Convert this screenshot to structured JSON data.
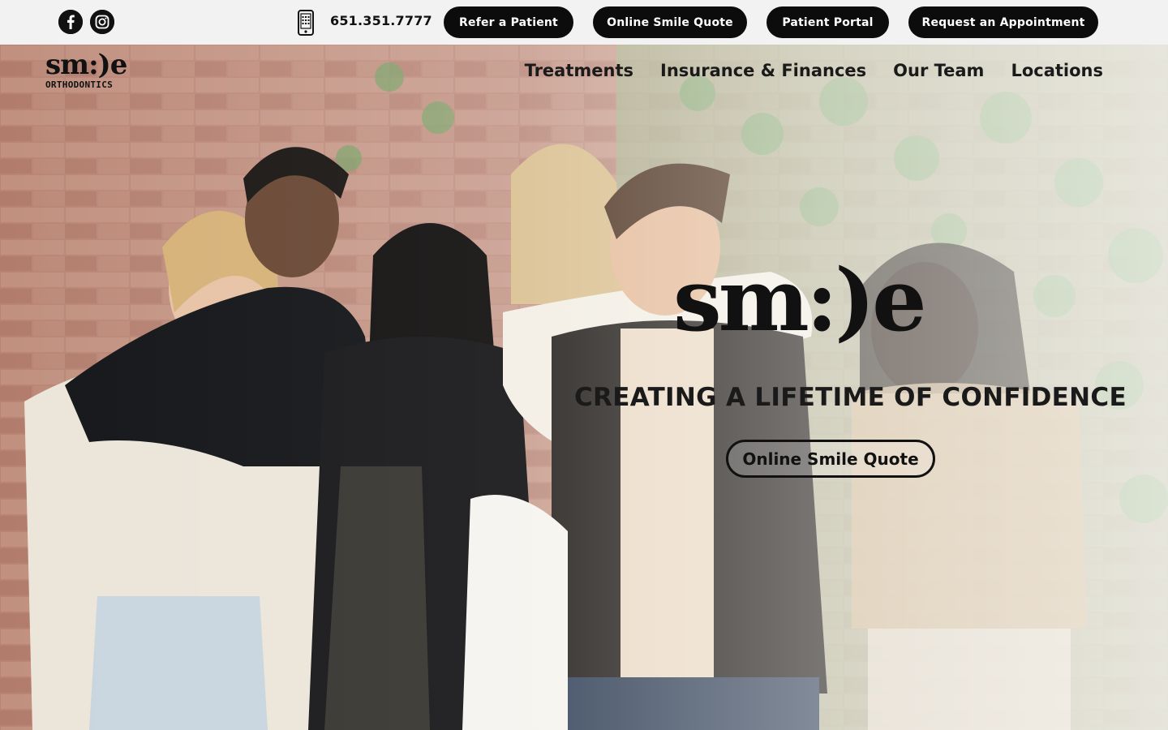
{
  "topbar": {
    "social": [
      {
        "label": "f",
        "icon": "facebook-icon"
      },
      {
        "label": "",
        "icon": "instagram-icon"
      }
    ],
    "phone": {
      "icon": "mobile-phone-icon",
      "number": "651.351.7777"
    },
    "buttons": {
      "refer": "Refer a Patient",
      "quote": "Online Smile Quote",
      "portal": "Patient Portal",
      "appointment": "Request an Appointment"
    }
  },
  "header": {
    "logo_word": "sm:)e",
    "logo_sub": "ORTHODONTICS",
    "nav": [
      "Treatments",
      "Insurance & Finances",
      "Our Team",
      "Locations"
    ]
  },
  "hero": {
    "brand": "sm:)e",
    "tagline": "CREATING A LIFETIME OF CONFIDENCE",
    "cta": "Online Smile Quote"
  },
  "colors": {
    "topbar_bg": "#f2f2f2",
    "pill_bg": "#0c0c0c",
    "text": "#111111",
    "brick": "#b07a6a",
    "ivy": "#6f9a5a"
  }
}
